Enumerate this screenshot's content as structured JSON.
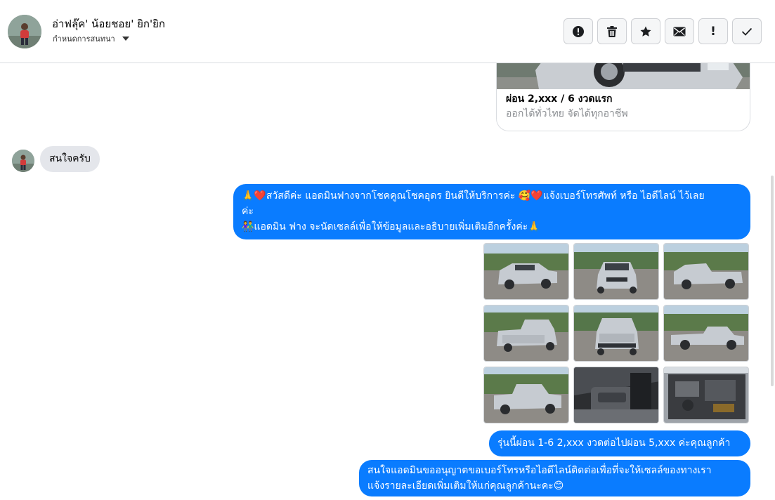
{
  "header": {
    "contact_name": "อ่าฟลุ๊ค' น้อยชอย' ยิก'ยิก",
    "conversation_settings": "กำหนดการสนทนา"
  },
  "toolbar": {
    "buttons": [
      {
        "icon": "alert-circle-icon"
      },
      {
        "icon": "trash-icon"
      },
      {
        "icon": "star-icon"
      },
      {
        "icon": "mail-icon"
      },
      {
        "icon": "exclamation-icon",
        "label": "!"
      },
      {
        "icon": "checkmark-icon"
      }
    ]
  },
  "product_card": {
    "title": "ผ่อน 2,xxx / 6 งวดแรก",
    "subtitle": "ออกได้ทั่วไทย จัดได้ทุกอาชีพ"
  },
  "messages": {
    "incoming_1": "สนใจครับ",
    "outgoing_1": {
      "line1": "🙏❤️สวัสดีค่ะ แอดมินฟางจากโชคคูณโชคอุดร ยินดีให้บริการค่ะ 🥰❤️แจ้งเบอร์โทรศัพท์ หรือ ไอดีไลน์  ไว้เลย",
      "line2": "ค่ะ",
      "line3": "👫แอดมิน ฟาง จะนัดเซลล์เพื่อให้ข้อมูลและอธิบายเพิ่มเติมอีกครั้งค่ะ🙏"
    },
    "outgoing_2": "รุ่นนี้ผ่อน 1-6  2,xxx  งวดต่อไปผ่อน 5,xxx ค่ะคุณลูกค้า",
    "outgoing_3": {
      "line1": "สนใจแอดมินขออนุญาตขอเบอร์โทรหรือไอดีไลน์ติดต่อเพื่อที่จะให้เซลล์ของทางเรา",
      "line2": "แจ้งรายละเอียดเพิ่มเติมให้แก่คุณลูกค้านะคะ😊"
    }
  },
  "colors": {
    "outgoing_bubble": "#0a7cff",
    "incoming_bubble": "#e4e6eb",
    "border": "#dadde1"
  }
}
